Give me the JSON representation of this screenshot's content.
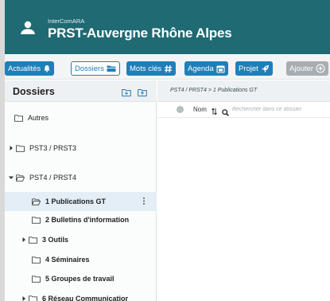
{
  "header": {
    "org_small": "InterComARA",
    "org_title": "PRST-Auvergne Rhône Alpes",
    "user_icon": "user-icon"
  },
  "nav": {
    "items": [
      {
        "label": "Actualités",
        "icon": "bell-icon"
      },
      {
        "label": "Dossiers",
        "icon": "folder-icon"
      },
      {
        "label": "Mots clés",
        "icon": "hashtag-icon"
      },
      {
        "label": "Agenda",
        "icon": "calendar-icon"
      },
      {
        "label": "Projet",
        "icon": "rocket-icon"
      },
      {
        "label": "Ajouter",
        "icon": "plus-circle-icon"
      }
    ],
    "active": "Dossiers"
  },
  "sidebar": {
    "title": "Dossiers",
    "items": [
      {
        "label": "Autres",
        "level": 0,
        "caret": "none",
        "bold": false
      },
      {
        "label": "PST3 / PRST3",
        "level": 0,
        "caret": "right",
        "bold": false
      },
      {
        "label": "PST4 / PRST4",
        "level": 0,
        "caret": "down",
        "bold": false
      },
      {
        "label": "1 Publications GT",
        "level": 1,
        "caret": "none",
        "bold": true,
        "selected": true
      },
      {
        "label": "2 Bulletins d'information",
        "level": 1,
        "caret": "none",
        "bold": true
      },
      {
        "label": "3 Outils",
        "level": 1,
        "caret": "right",
        "bold": true
      },
      {
        "label": "4 Séminaires",
        "level": 1,
        "caret": "none",
        "bold": true
      },
      {
        "label": "5 Groupes de travail",
        "level": 1,
        "caret": "none",
        "bold": true
      },
      {
        "label": "6 Réseau Communicatior",
        "level": 1,
        "caret": "right",
        "bold": true
      }
    ]
  },
  "content": {
    "breadcrumb": "PST4 / PRST4 > 1 Publications GT",
    "column_name": "Nom",
    "search_placeholder": "Rechercher dans ce dossier"
  },
  "colors": {
    "header_bg": "#1f6a73",
    "button_blue": "#1f7fb8",
    "button_grey": "#a8adb1",
    "selected_row": "#e3eef7"
  }
}
